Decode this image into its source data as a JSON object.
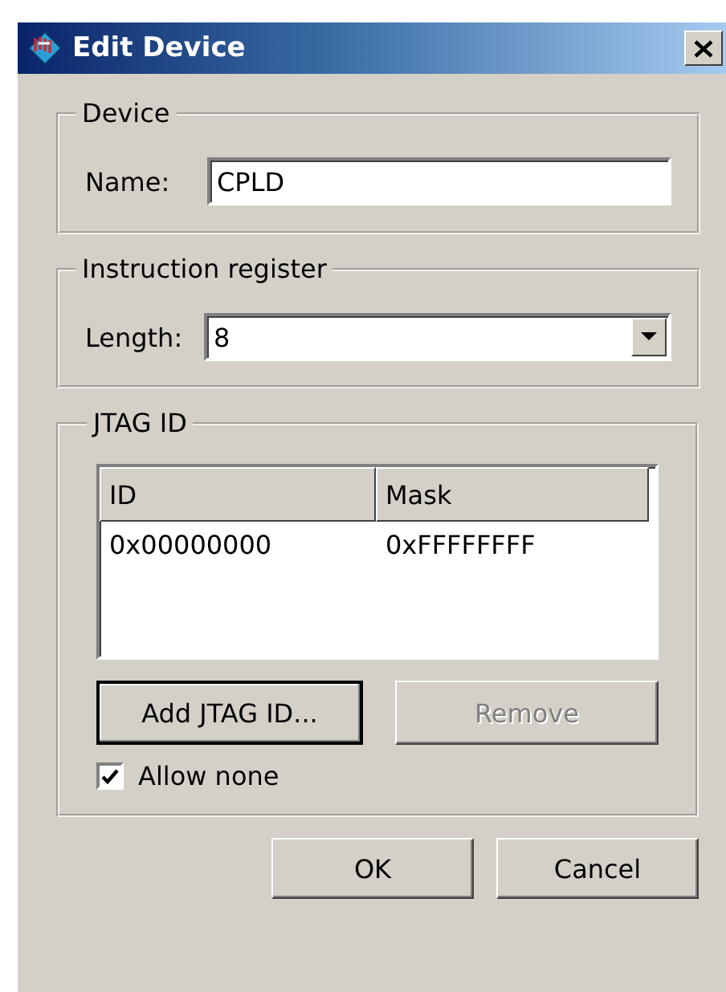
{
  "window": {
    "title": "Edit Device"
  },
  "device": {
    "title": "Device",
    "name_label": "Name:",
    "name_value": "CPLD"
  },
  "instruction_register": {
    "title": "Instruction register",
    "length_label": "Length:",
    "length_value": "8"
  },
  "jtag_id": {
    "title": "JTAG ID",
    "columns": [
      "ID",
      "Mask"
    ],
    "rows": [
      [
        "0x00000000",
        "0xFFFFFFFF"
      ]
    ],
    "buttons": [
      {
        "label": "Add JTAG ID...",
        "disabled": false
      },
      {
        "label": "Remove",
        "disabled": true
      }
    ],
    "allow_none": {
      "label": "Allow none",
      "checked": true
    }
  },
  "buttons": [
    {
      "label": "OK"
    },
    {
      "label": "Cancel"
    }
  ]
}
